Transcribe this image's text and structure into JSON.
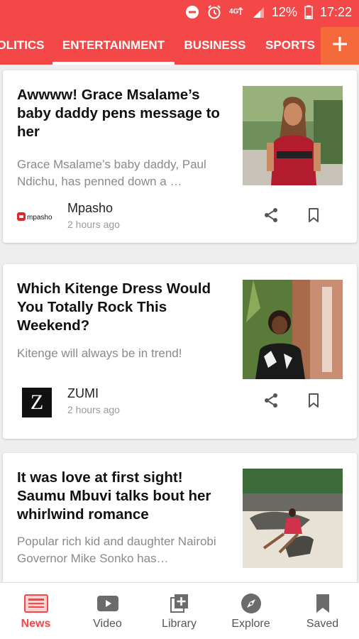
{
  "status_bar": {
    "battery": "12%",
    "time": "17:22",
    "icons": [
      "do-not-disturb-icon",
      "alarm-icon",
      "4g-icon",
      "signal-icon",
      "battery-icon"
    ]
  },
  "tabs": [
    {
      "label": "OLITICS",
      "active": false
    },
    {
      "label": "ENTERTAINMENT",
      "active": true
    },
    {
      "label": "BUSINESS",
      "active": false
    },
    {
      "label": "SPORTS",
      "active": false
    }
  ],
  "tab_add_icon": "plus-icon",
  "articles": [
    {
      "title": "Awwww! Grace Msalame’s baby daddy pens message to her",
      "snippet": "Grace Msalame’s baby daddy, Paul Ndichu, has penned down a …",
      "source": "Mpasho",
      "source_logo_text": "mpasho",
      "time": "2 hours ago"
    },
    {
      "title": "Which Kitenge Dress Would You Totally Rock This Weekend?",
      "snippet": "Kitenge will always be in trend!",
      "source": "ZUMI",
      "source_logo_text": "Z",
      "time": "2 hours ago"
    },
    {
      "title": "It was love at first sight! Saumu Mbuvi talks bout her whirlwind romance",
      "snippet": "Popular rich kid and daughter Nairobi Governor Mike Sonko has…"
    }
  ],
  "bottom_nav": [
    {
      "label": "News",
      "icon": "news-icon",
      "active": true
    },
    {
      "label": "Video",
      "icon": "video-icon",
      "active": false
    },
    {
      "label": "Library",
      "icon": "library-icon",
      "active": false
    },
    {
      "label": "Explore",
      "icon": "compass-icon",
      "active": false
    },
    {
      "label": "Saved",
      "icon": "bookmark-icon",
      "active": false
    }
  ],
  "colors": {
    "brand_red": "#f44848",
    "add_button_orange": "#f56a3a",
    "active_nav": "#f44848"
  }
}
